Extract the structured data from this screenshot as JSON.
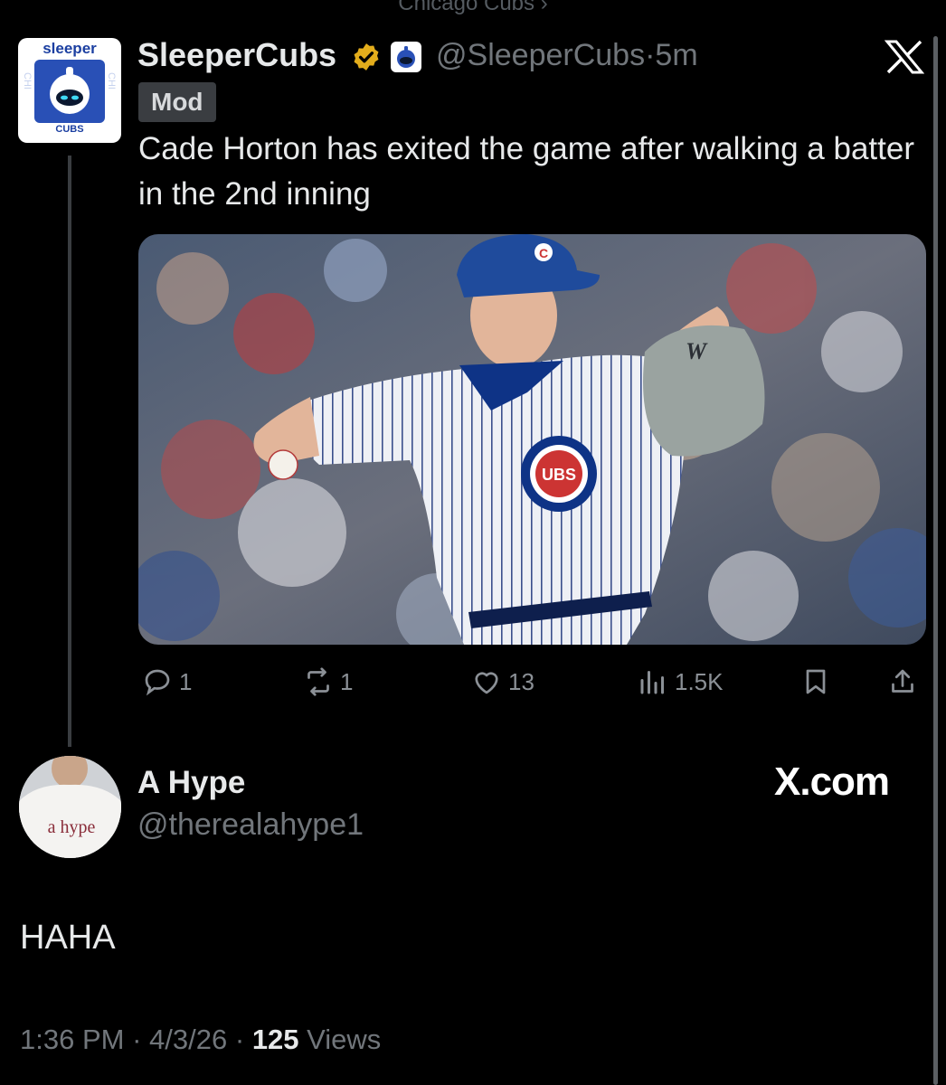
{
  "community": {
    "label": "Chicago Cubs ›"
  },
  "tweet": {
    "avatar": {
      "brand": "sleeper",
      "team": "CUBS",
      "side_left": "CHI",
      "side_right": "CHI"
    },
    "display_name": "SleeperCubs",
    "handle": "@SleeperCubs",
    "separator": "·",
    "time": "5m",
    "badge": "Mod",
    "text": "Cade Horton has exited the game after walking a batter in the 2nd inning",
    "photo": {
      "cap_letter": "C",
      "jersey_logo": "UBS",
      "glove_logo": "W"
    },
    "actions": {
      "replies": "1",
      "reposts": "1",
      "likes": "13",
      "views": "1.5K"
    }
  },
  "reply": {
    "avatar_text": "a hype",
    "display_name": "A Hype",
    "handle": "@therealahype1",
    "watermark": "X.com",
    "text": "HAHA",
    "time": "1:36 PM",
    "date": "4/3/26",
    "views_count": "125",
    "views_label": "Views",
    "separator": "·"
  },
  "colors": {
    "background": "#000000",
    "secondary_text": "#71767b",
    "verified_gold": "#e3ad1c",
    "cubs_blue": "#0e3386",
    "cubs_red": "#cc3433"
  },
  "icons": [
    "verified-badge-icon",
    "affiliate-badge-icon",
    "x-logo-icon",
    "reply-icon",
    "repost-icon",
    "like-icon",
    "views-icon",
    "bookmark-icon",
    "share-icon"
  ]
}
